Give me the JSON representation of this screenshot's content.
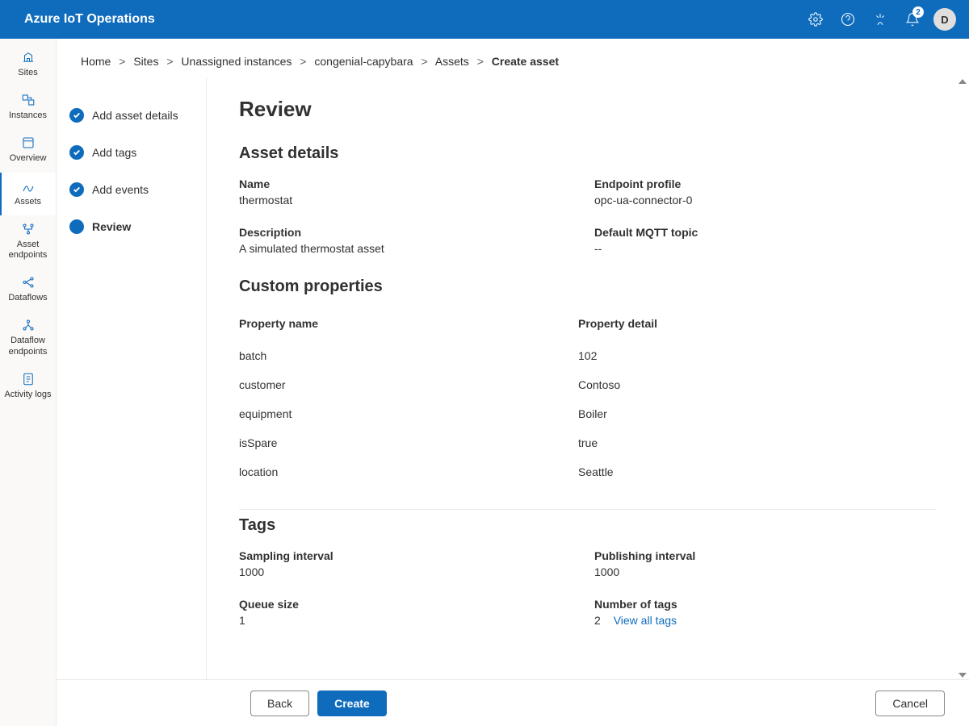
{
  "header": {
    "title": "Azure IoT Operations",
    "avatar_initial": "D",
    "notification_count": "2"
  },
  "sidebar": {
    "items": [
      {
        "label": "Sites"
      },
      {
        "label": "Instances"
      },
      {
        "label": "Overview"
      },
      {
        "label": "Assets"
      },
      {
        "label": "Asset endpoints"
      },
      {
        "label": "Dataflows"
      },
      {
        "label": "Dataflow endpoints"
      },
      {
        "label": "Activity logs"
      }
    ]
  },
  "breadcrumb": {
    "items": [
      "Home",
      "Sites",
      "Unassigned instances",
      "congenial-capybara",
      "Assets"
    ],
    "current": "Create asset"
  },
  "steps": [
    {
      "label": "Add asset details"
    },
    {
      "label": "Add tags"
    },
    {
      "label": "Add events"
    },
    {
      "label": "Review"
    }
  ],
  "page_title": "Review",
  "sections": {
    "asset_details": {
      "heading": "Asset details",
      "name_label": "Name",
      "name_value": "thermostat",
      "endpoint_label": "Endpoint profile",
      "endpoint_value": "opc-ua-connector-0",
      "description_label": "Description",
      "description_value": "A simulated thermostat asset",
      "mqtt_label": "Default MQTT topic",
      "mqtt_value": "--"
    },
    "custom_properties": {
      "heading": "Custom properties",
      "col_name": "Property name",
      "col_detail": "Property detail",
      "rows": [
        {
          "name": "batch",
          "detail": "102"
        },
        {
          "name": "customer",
          "detail": "Contoso"
        },
        {
          "name": "equipment",
          "detail": "Boiler"
        },
        {
          "name": "isSpare",
          "detail": "true"
        },
        {
          "name": "location",
          "detail": "Seattle"
        }
      ]
    },
    "tags": {
      "heading": "Tags",
      "sampling_label": "Sampling interval",
      "sampling_value": "1000",
      "publishing_label": "Publishing interval",
      "publishing_value": "1000",
      "queue_label": "Queue size",
      "queue_value": "1",
      "count_label": "Number of tags",
      "count_value": "2",
      "view_all": "View all tags"
    }
  },
  "footer": {
    "back": "Back",
    "create": "Create",
    "cancel": "Cancel"
  }
}
